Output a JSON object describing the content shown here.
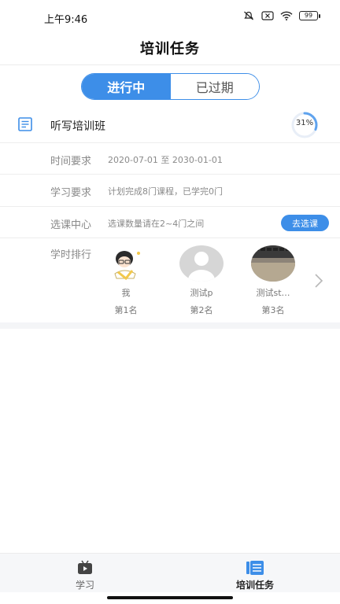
{
  "status_bar": {
    "time": "上午9:46",
    "battery": "99"
  },
  "header": {
    "title": "培训任务"
  },
  "segment": {
    "tabs": [
      {
        "label": "进行中",
        "active": true
      },
      {
        "label": "已过期",
        "active": false
      }
    ]
  },
  "course": {
    "icon": "document-icon",
    "name": "听写培训班",
    "progress_text": "31%",
    "progress_value": 0.31
  },
  "details": {
    "time_label": "时间要求",
    "time_value": "2020-07-01 至 2030-01-01",
    "study_label": "学习要求",
    "study_value": "计划完成8门课程，已学完0门",
    "select_label": "选课中心",
    "select_value": "选课数量请在2~4门之间",
    "select_button": "去选课"
  },
  "ranking": {
    "label": "学时排行",
    "users": [
      {
        "name": "我",
        "rank": "第1名"
      },
      {
        "name": "测试p",
        "rank": "第2名"
      },
      {
        "name": "测试st…",
        "rank": "第3名"
      }
    ]
  },
  "tab_bar": {
    "tabs": [
      {
        "label": "学习",
        "icon": "tv-icon",
        "active": false
      },
      {
        "label": "培训任务",
        "icon": "list-icon",
        "active": true
      }
    ]
  },
  "colors": {
    "accent": "#3d8ee8"
  }
}
